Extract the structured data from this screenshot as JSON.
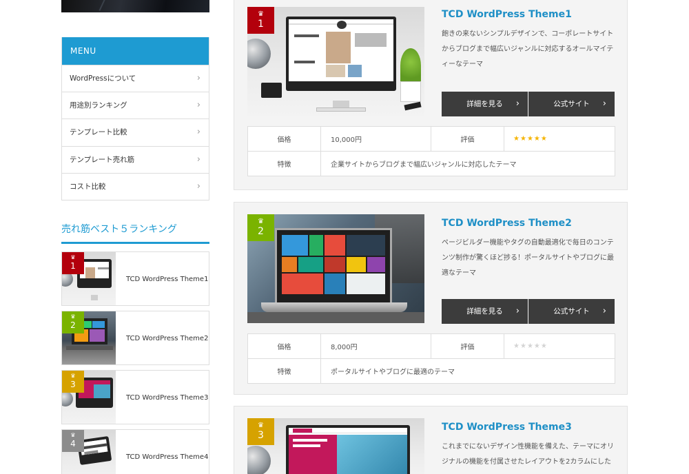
{
  "menu": {
    "title": "MENU",
    "items": [
      {
        "label": "WordPressについて"
      },
      {
        "label": "用途別ランキング"
      },
      {
        "label": "テンプレート比較"
      },
      {
        "label": "テンプレート売れ筋"
      },
      {
        "label": "コスト比較"
      }
    ],
    "arrow": "›"
  },
  "ranking": {
    "title": "売れ筋ベスト５ランキング",
    "items": [
      {
        "rank": "1",
        "name": "TCD WordPress Theme1",
        "badge_color": "#b3000c"
      },
      {
        "rank": "2",
        "name": "TCD WordPress Theme2",
        "badge_color": "#7ab300"
      },
      {
        "rank": "3",
        "name": "TCD WordPress Theme3",
        "badge_color": "#d6a200"
      },
      {
        "rank": "4",
        "name": "TCD WordPress Theme4",
        "badge_color": "#8c8c8c"
      }
    ]
  },
  "crown_glyph": "♛",
  "products": [
    {
      "rank": "1",
      "badge_color": "#b3000c",
      "title": "TCD WordPress Theme1",
      "description": "飽きの来ないシンプルデザインで、コーポレートサイトからブログまで幅広いジャンルに対応するオールマイティーなテーマ",
      "detail_button": "詳細を見る",
      "official_button": "公式サイト",
      "price_label": "価格",
      "price": "10,000円",
      "rating_label": "評価",
      "rating": 5,
      "feature_label": "特徴",
      "feature": "企業サイトからブログまで幅広いジャンルに対応したテーマ"
    },
    {
      "rank": "2",
      "badge_color": "#7ab300",
      "title": "TCD WordPress Theme2",
      "description": "ページビルダー機能やタグの自動最適化で毎日のコンテンツ制作が驚くほど捗る！ポータルサイトやブログに最適なテーマ",
      "detail_button": "詳細を見る",
      "official_button": "公式サイト",
      "price_label": "価格",
      "price": "8,000円",
      "rating_label": "評価",
      "rating": 0,
      "feature_label": "特徴",
      "feature": "ポータルサイトやブログに最適のテーマ"
    },
    {
      "rank": "3",
      "badge_color": "#d6a200",
      "title": "TCD WordPress Theme3",
      "description": "これまでにないデザイン性機能を備えた、テーマにオリジナルの機能を付属させたレイアウトを2カラムにした"
    }
  ],
  "icons": {
    "chevron": "›",
    "star": "★"
  }
}
